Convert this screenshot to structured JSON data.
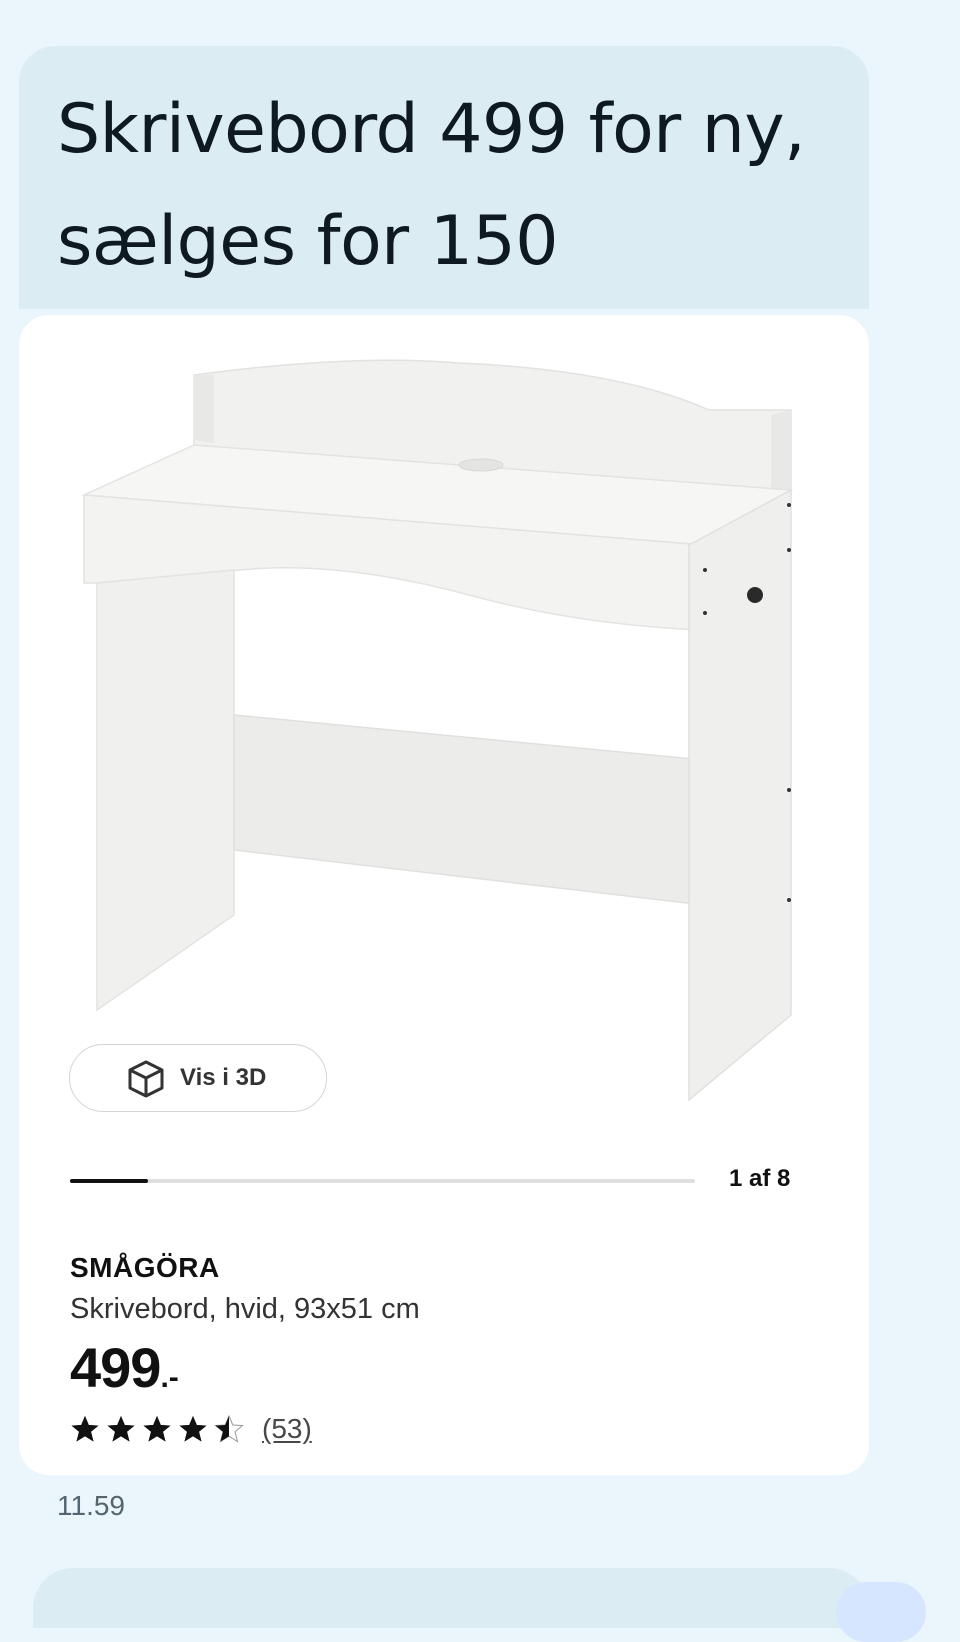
{
  "message": {
    "text": "Skrivebord 499 for ny,\nsælges for 150",
    "timestamp": "11.59"
  },
  "product_card": {
    "view_3d_label": "Vis i 3D",
    "image_counter": "1 af 8",
    "gallery_progress_fraction": 0.125,
    "name": "SMÅGÖRA",
    "description": "Skrivebord, hvid, 93x51 cm",
    "price_main": "499",
    "price_suffix": ".-",
    "rating": {
      "stars": 4.5,
      "max": 5,
      "count_label": "(53)"
    }
  },
  "icons": [
    "cube-3d-icon",
    "star-icon"
  ],
  "colors": {
    "chat_background": "#eaf6fb",
    "bubble": "#dcecf3",
    "card": "#ffffff",
    "text": "#111111"
  }
}
